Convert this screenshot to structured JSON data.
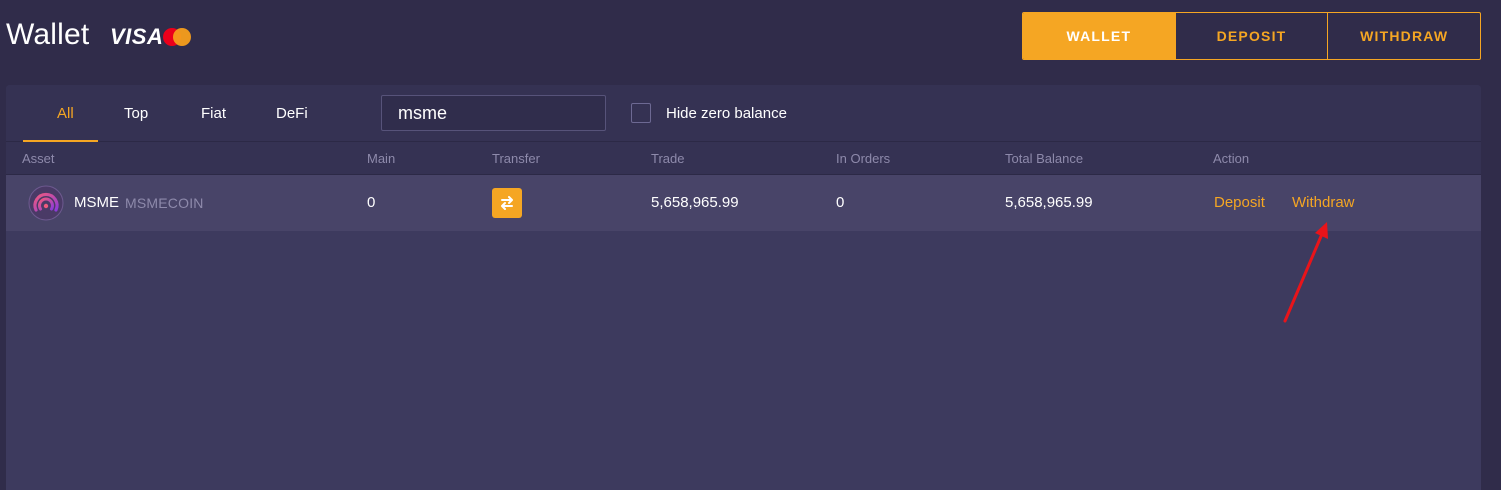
{
  "header": {
    "title": "Wallet",
    "visa_text": "VISA",
    "tabs": [
      {
        "label": "WALLET",
        "active": true
      },
      {
        "label": "DEPOSIT",
        "active": false
      },
      {
        "label": "WITHDRAW",
        "active": false
      }
    ]
  },
  "filters": {
    "tabs": [
      {
        "label": "All",
        "active": true
      },
      {
        "label": "Top",
        "active": false
      },
      {
        "label": "Fiat",
        "active": false
      },
      {
        "label": "DeFi",
        "active": false
      }
    ],
    "search_value": "msme",
    "hide_zero_label": "Hide zero balance",
    "hide_zero_checked": false
  },
  "table": {
    "columns": [
      "Asset",
      "Main",
      "Transfer",
      "Trade",
      "In Orders",
      "Total Balance",
      "Action"
    ],
    "rows": [
      {
        "symbol": "MSME",
        "name": "MSMECOIN",
        "main": "0",
        "trade": "5,658,965.99",
        "in_orders": "0",
        "total_balance": "5,658,965.99",
        "actions": [
          "Deposit",
          "Withdraw"
        ]
      }
    ]
  },
  "icons": {
    "coin": "msme-coin-icon",
    "transfer": "transfer-arrows-icon",
    "annotation": "red-arrow-annotation"
  },
  "colors": {
    "accent": "#f5a623",
    "background": "#302c4a",
    "panel": "#3d3a5e",
    "row": "#484468",
    "annotation": "#e8141a"
  }
}
